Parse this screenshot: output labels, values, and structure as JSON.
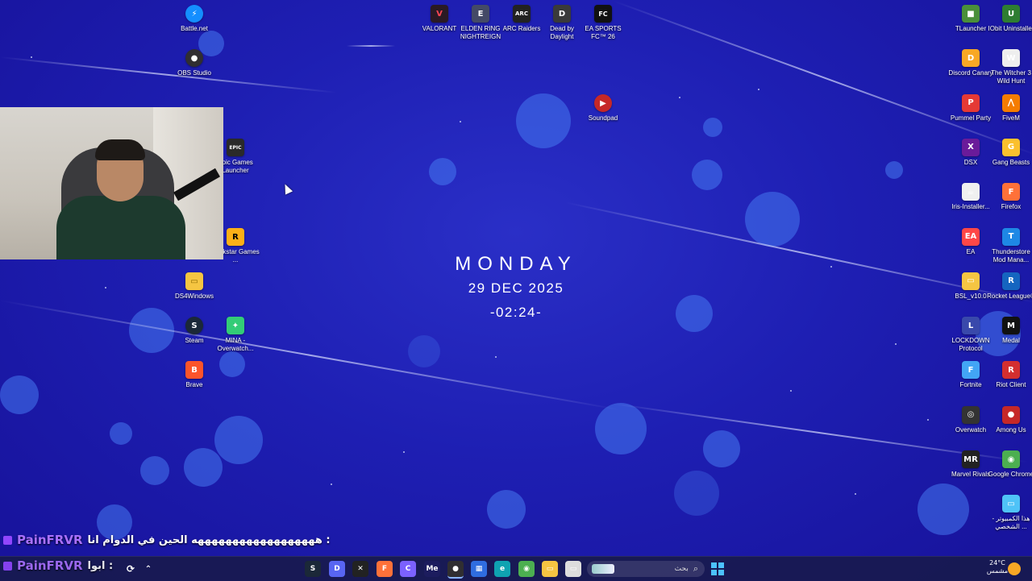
{
  "desktop": {
    "left_icons": [
      {
        "label": "Battle.net",
        "icon": "battlenet-icon",
        "color": "#148eff",
        "glyph": "⚡"
      },
      {
        "label": "OBS Studio",
        "icon": "obs-icon",
        "color": "#302e31",
        "glyph": "●"
      },
      {
        "label": "Epic Games Launcher",
        "icon": "epic-games-icon",
        "color": "#2a2a2a",
        "glyph": "EPIC"
      },
      {
        "label": "Rockstar Games ...",
        "icon": "rockstar-icon",
        "color": "#fcaf17",
        "glyph": "R"
      },
      {
        "label": "DS4Windows",
        "icon": "folder-icon",
        "color": "#f5c542",
        "glyph": "▭"
      },
      {
        "label": "Steam",
        "icon": "steam-icon",
        "color": "#1b2838",
        "glyph": "S"
      },
      {
        "label": "MINA - Overwatch...",
        "icon": "mina-icon",
        "color": "#3c7",
        "glyph": "✦"
      },
      {
        "label": "Brave",
        "icon": "brave-icon",
        "color": "#fb542b",
        "glyph": "B"
      }
    ],
    "top_icons": [
      {
        "label": "VALORANT",
        "icon": "valorant-icon",
        "color": "#2a1a24",
        "glyph": "V"
      },
      {
        "label": "ELDEN RING NIGHTREIGN",
        "icon": "elden-ring-icon",
        "color": "#444a66",
        "glyph": "E"
      },
      {
        "label": "ARC Raiders",
        "icon": "arc-raiders-icon",
        "color": "#222",
        "glyph": "ARC"
      },
      {
        "label": "Dead by Daylight",
        "icon": "dead-by-daylight-icon",
        "color": "#3a3a3a",
        "glyph": "D"
      },
      {
        "label": "EA SPORTS FC™ 26",
        "icon": "ea-fc-icon",
        "color": "#111",
        "glyph": "FC"
      },
      {
        "label": "Soundpad",
        "icon": "soundpad-icon",
        "color": "#c62828",
        "glyph": "▶"
      }
    ],
    "right_icons": [
      {
        "label": "TLauncher",
        "icon": "tlauncher-icon",
        "color": "#4a8f3a",
        "glyph": "■"
      },
      {
        "label": "IObit Uninstaller",
        "icon": "iobit-icon",
        "color": "#2e7d32",
        "glyph": "U"
      },
      {
        "label": "Discord Canary",
        "icon": "discord-canary-icon",
        "color": "#f9a825",
        "glyph": "D"
      },
      {
        "label": "The Witcher 3 Wild Hunt",
        "icon": "witcher-icon",
        "color": "#eee",
        "glyph": "W"
      },
      {
        "label": "Pummel Party",
        "icon": "pummel-party-icon",
        "color": "#e53935",
        "glyph": "P"
      },
      {
        "label": "FiveM",
        "icon": "fivem-icon",
        "color": "#f57c00",
        "glyph": "⋀"
      },
      {
        "label": "DSX",
        "icon": "dsx-icon",
        "color": "#6a1b9a",
        "glyph": "X"
      },
      {
        "label": "Gang Beasts",
        "icon": "gang-beasts-icon",
        "color": "#fbc02d",
        "glyph": "G"
      },
      {
        "label": "Iris-Installer...",
        "icon": "java-icon",
        "color": "#f0f0f0",
        "glyph": "☕"
      },
      {
        "label": "Firefox",
        "icon": "firefox-icon",
        "color": "#ff7139",
        "glyph": "F"
      },
      {
        "label": "EA",
        "icon": "ea-icon",
        "color": "#ff4747",
        "glyph": "EA"
      },
      {
        "label": "Thunderstore Mod Mana...",
        "icon": "thunderstore-icon",
        "color": "#1e88e5",
        "glyph": "T"
      },
      {
        "label": "BSL_v10.0",
        "icon": "folder-icon",
        "color": "#f5c542",
        "glyph": "▭"
      },
      {
        "label": "Rocket League®",
        "icon": "rocket-league-icon",
        "color": "#1565c0",
        "glyph": "R"
      },
      {
        "label": "LOCKDOWN Protocol",
        "icon": "lockdown-icon",
        "color": "#3949ab",
        "glyph": "L"
      },
      {
        "label": "Medal",
        "icon": "medal-icon",
        "color": "#111",
        "glyph": "M"
      },
      {
        "label": "Fortnite",
        "icon": "fortnite-icon",
        "color": "#42a5f5",
        "glyph": "F"
      },
      {
        "label": "Riot Client",
        "icon": "riot-client-icon",
        "color": "#d32f2f",
        "glyph": "R"
      },
      {
        "label": "Overwatch",
        "icon": "overwatch-icon",
        "color": "#333",
        "glyph": "◎"
      },
      {
        "label": "Among Us",
        "icon": "among-us-icon",
        "color": "#c62828",
        "glyph": "●"
      },
      {
        "label": "Marvel Rivals",
        "icon": "marvel-rivals-icon",
        "color": "#222",
        "glyph": "MR"
      },
      {
        "label": "Google Chrome",
        "icon": "chrome-icon",
        "color": "#4caf50",
        "glyph": "◉"
      },
      {
        "label": "هذا الكمبيوتر - الشخصي ...",
        "icon": "this-pc-icon",
        "color": "#4fc3f7",
        "glyph": "▭"
      }
    ]
  },
  "clock": {
    "day": "MONDAY",
    "date": "29 DEC 2025",
    "time": "-02:24-"
  },
  "chat": {
    "line1_user": "PainFRVR",
    "line1_msg": ": ههههههههههههههههههه الحين في الدوام انا",
    "line2_user": "PainFRVR",
    "line2_msg": ": ابوا"
  },
  "taskbar": {
    "search_placeholder": "بحث",
    "weather_temp": "24°C",
    "weather_text": "مشمس",
    "items": [
      {
        "name": "steam-taskbar-icon",
        "color": "#1b2838",
        "glyph": "S"
      },
      {
        "name": "discord-taskbar-icon",
        "color": "#5865f2",
        "glyph": "D"
      },
      {
        "name": "capcut-taskbar-icon",
        "color": "#222",
        "glyph": "✕"
      },
      {
        "name": "firefox-taskbar-icon",
        "color": "#ff7139",
        "glyph": "F"
      },
      {
        "name": "copilot-taskbar-icon",
        "color": "#7b61ff",
        "glyph": "C"
      },
      {
        "name": "media-encoder-taskbar-icon",
        "color": "#1c1c5e",
        "glyph": "Me"
      },
      {
        "name": "obs-taskbar-icon",
        "color": "#302e31",
        "glyph": "●"
      },
      {
        "name": "store-taskbar-icon",
        "color": "#2f6de0",
        "glyph": "▦"
      },
      {
        "name": "edge-taskbar-icon",
        "color": "#0fa3b1",
        "glyph": "e"
      },
      {
        "name": "chrome-taskbar-icon",
        "color": "#4caf50",
        "glyph": "◉"
      },
      {
        "name": "file-explorer-taskbar-icon",
        "color": "#f5c542",
        "glyph": "▭"
      },
      {
        "name": "app-taskbar-icon",
        "color": "#ddd",
        "glyph": "▭"
      }
    ]
  }
}
